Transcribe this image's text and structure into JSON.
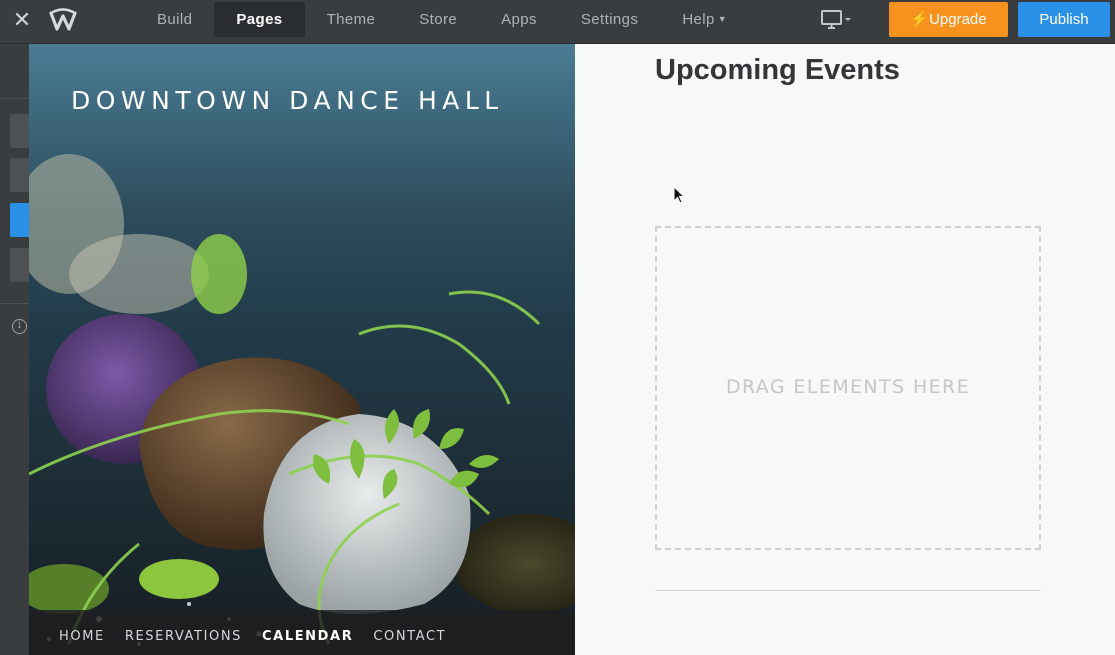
{
  "topbar": {
    "close_icon": "close-icon",
    "logo_icon": "weebly-logo-icon",
    "nav": [
      {
        "label": "Build",
        "active": false
      },
      {
        "label": "Pages",
        "active": true
      },
      {
        "label": "Theme",
        "active": false
      },
      {
        "label": "Store",
        "active": false
      },
      {
        "label": "Apps",
        "active": false
      },
      {
        "label": "Settings",
        "active": false
      }
    ],
    "help_label": "Help",
    "device_icon": "desktop-monitor-icon",
    "upgrade_label": "Upgrade",
    "publish_label": "Publish"
  },
  "site": {
    "title": "DOWNTOWN DANCE HALL",
    "nav": [
      "HOME",
      "RESERVATIONS",
      "CALENDAR",
      "CONTACT"
    ],
    "current_nav": "CALENDAR"
  },
  "content": {
    "heading": "Upcoming Events",
    "dropzone_text": "DRAG ELEMENTS HERE"
  },
  "colors": {
    "upgrade": "#f7921e",
    "publish": "#2a90e8",
    "topbar": "#3a3d40"
  }
}
